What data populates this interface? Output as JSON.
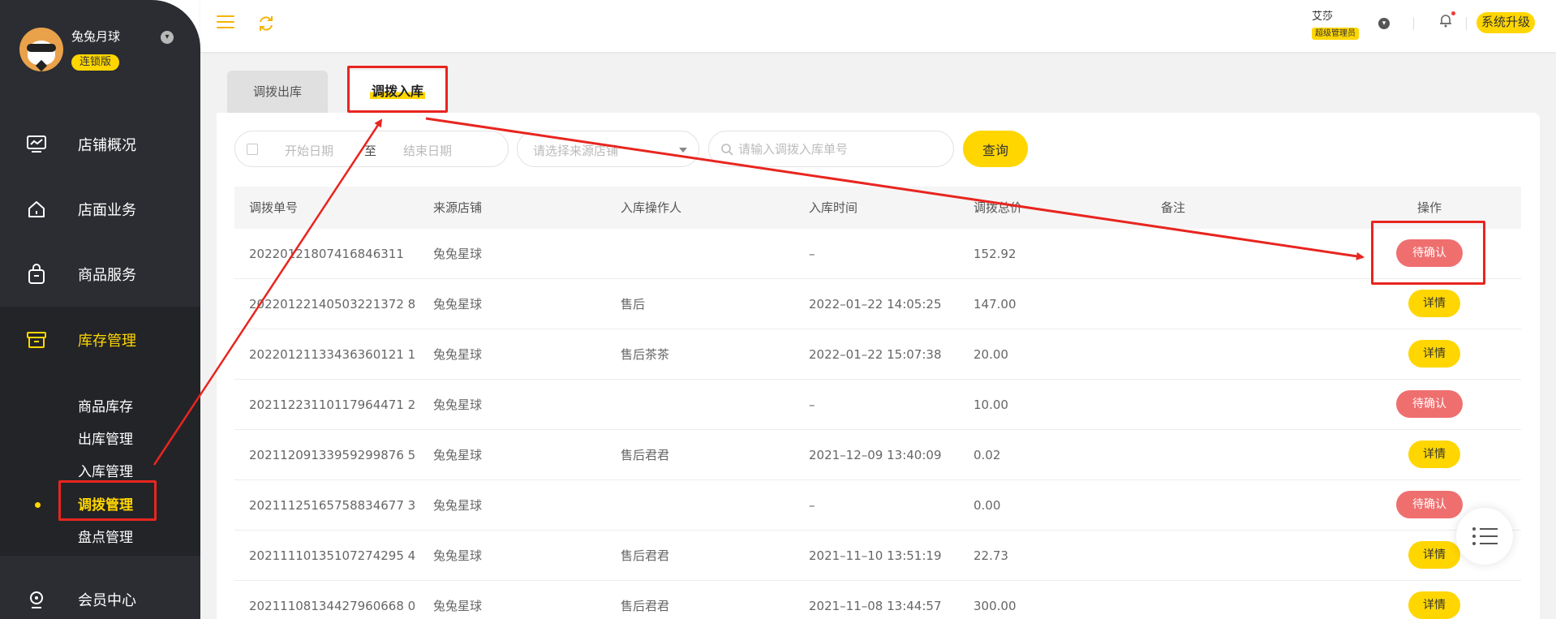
{
  "sidebar": {
    "store_name": "兔兔月球",
    "badge": "连锁版",
    "nav": [
      {
        "label": "店铺概况",
        "icon": "dashboard-icon"
      },
      {
        "label": "店面业务",
        "icon": "home-icon"
      },
      {
        "label": "商品服务",
        "icon": "bag-icon"
      },
      {
        "label": "库存管理",
        "icon": "inventory-icon"
      },
      {
        "label": "会员中心",
        "icon": "member-icon"
      }
    ],
    "sub_nav": [
      "商品库存",
      "出库管理",
      "入库管理",
      "调拨管理",
      "盘点管理"
    ]
  },
  "topbar": {
    "user_name": "艾莎",
    "user_role": "超级管理员",
    "upgrade_label": "系统升级"
  },
  "tabs": [
    "调拨出库",
    "调拨入库"
  ],
  "filters": {
    "start_placeholder": "开始日期",
    "separator": "至",
    "end_placeholder": "结束日期",
    "store_placeholder": "请选择来源店铺",
    "search_placeholder": "请输入调拨入库单号",
    "query_label": "查询"
  },
  "table": {
    "headers": [
      "调拨单号",
      "来源店铺",
      "入库操作人",
      "入库时间",
      "调拨总价",
      "备注",
      "操作"
    ],
    "rows": [
      {
        "no": "20220121807416846311",
        "store": "兔兔星球",
        "operator": "",
        "time": "–",
        "total": "152.92",
        "remark": "",
        "action": "待确认"
      },
      {
        "no": "20220122140503221372 8",
        "store": "兔兔星球",
        "operator": "售后",
        "time": "2022–01–22 14:05:25",
        "total": "147.00",
        "remark": "",
        "action": "详情"
      },
      {
        "no": "20220121133436360121 1",
        "store": "兔兔星球",
        "operator": "售后茶茶",
        "time": "2022–01–22 15:07:38",
        "total": "20.00",
        "remark": "",
        "action": "详情"
      },
      {
        "no": "20211223110117964471 2",
        "store": "兔兔星球",
        "operator": "",
        "time": "–",
        "total": "10.00",
        "remark": "",
        "action": "待确认"
      },
      {
        "no": "20211209133959299876 5",
        "store": "兔兔星球",
        "operator": "售后君君",
        "time": "2021–12–09 13:40:09",
        "total": "0.02",
        "remark": "",
        "action": "详情"
      },
      {
        "no": "20211125165758834677 3",
        "store": "兔兔星球",
        "operator": "",
        "time": "–",
        "total": "0.00",
        "remark": "",
        "action": "待确认"
      },
      {
        "no": "20211110135107274295 4",
        "store": "兔兔星球",
        "operator": "售后君君",
        "time": "2021–11–10 13:51:19",
        "total": "22.73",
        "remark": "",
        "action": "详情"
      },
      {
        "no": "20211108134427960668 0",
        "store": "兔兔星球",
        "operator": "售后君君",
        "time": "2021–11–08 13:44:57",
        "total": "300.00",
        "remark": "",
        "action": "详情"
      }
    ]
  },
  "colors": {
    "accent": "#ffd600",
    "sidebar": "#2b2d32",
    "pending": "#ef6f6f",
    "annotation": "#e8251f"
  }
}
